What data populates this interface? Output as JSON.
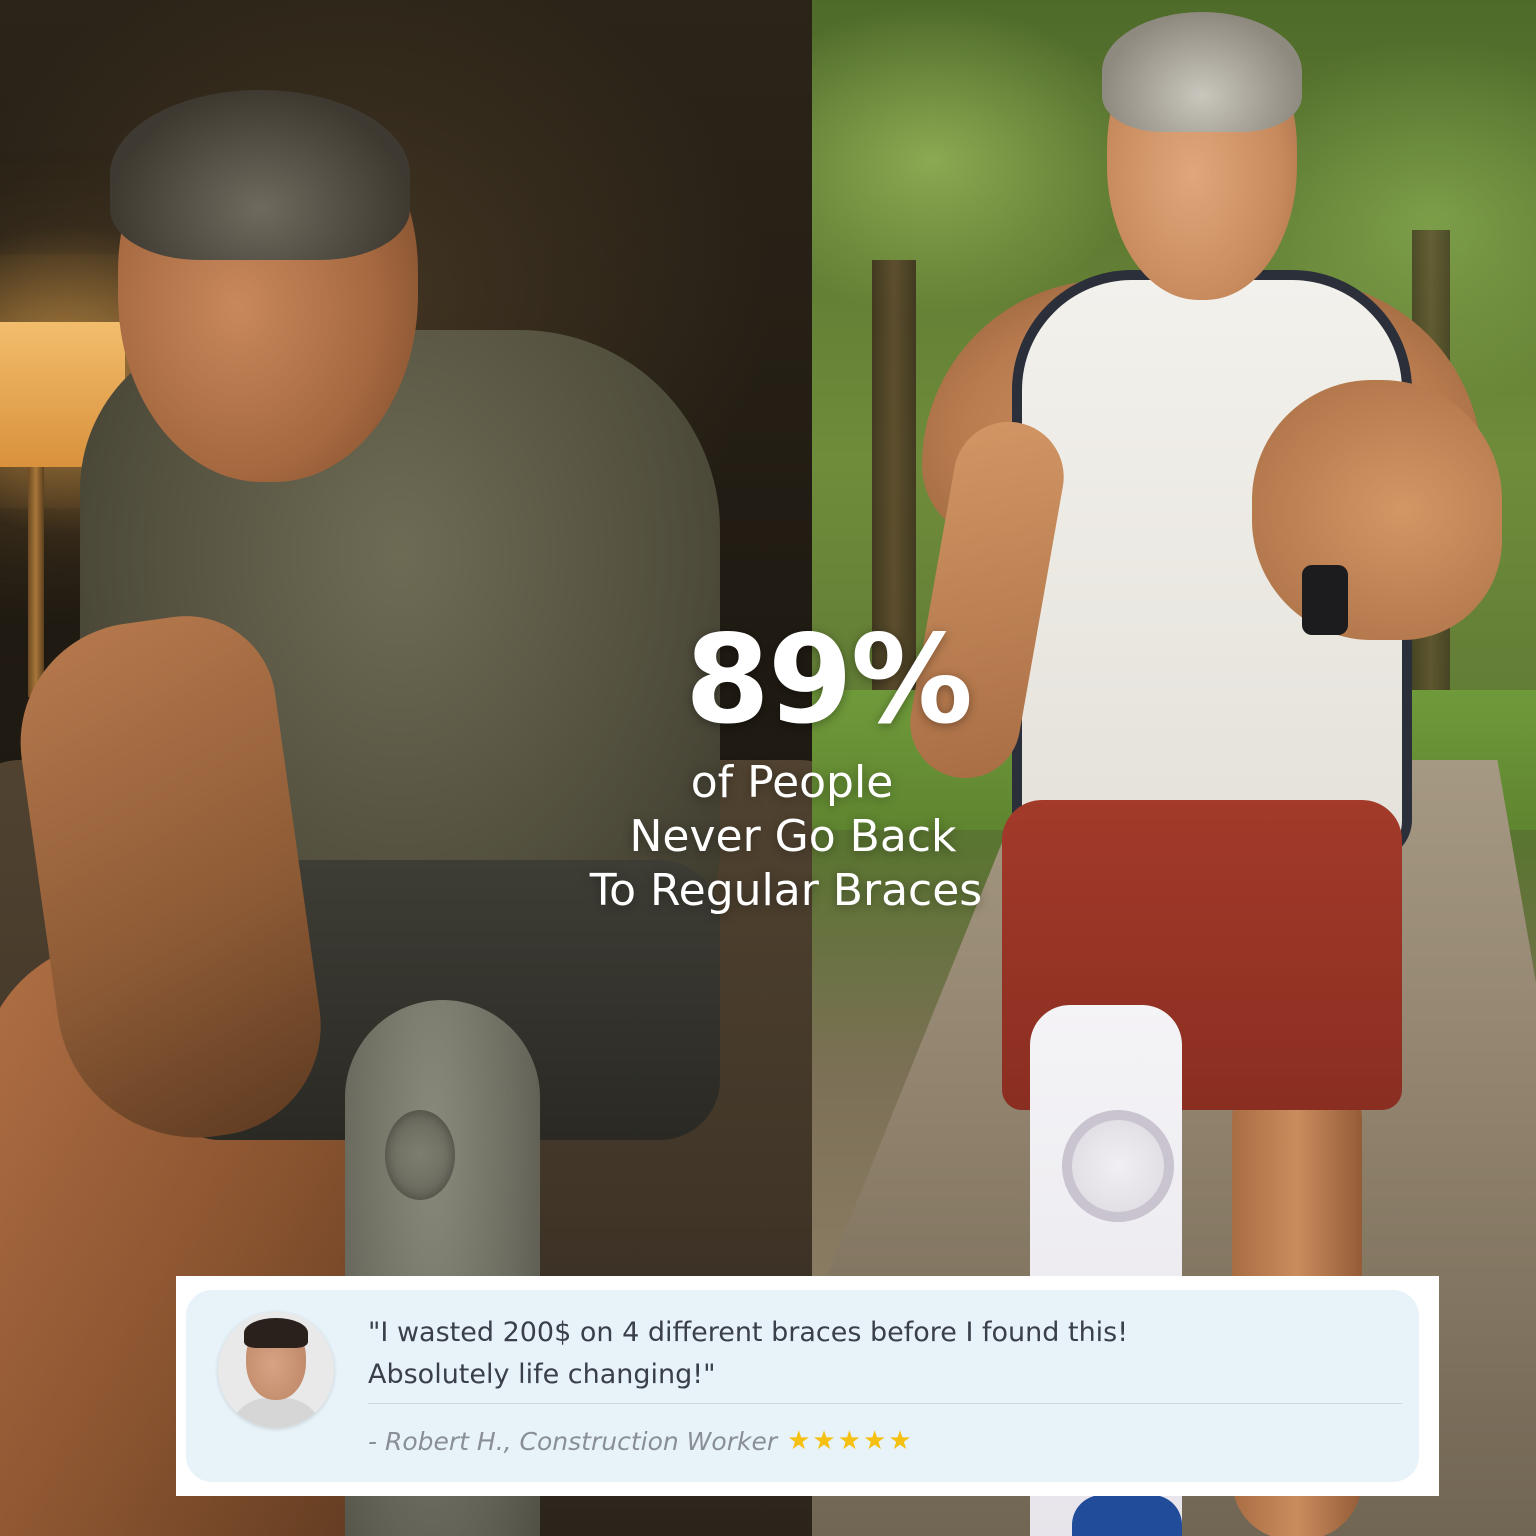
{
  "headline": {
    "stat": "89%",
    "line_1": "of People",
    "line_2": "Never Go Back",
    "line_3": "To Regular Braces"
  },
  "testimonial": {
    "quote_line_1": "\"I wasted 200$ on 4 different braces before I found this!",
    "quote_line_2": "Absolutely life changing!\"",
    "attribution": "- Robert H., Construction Worker",
    "rating_stars": "★★★★★",
    "rating": 5,
    "avatar_icon": "person-avatar"
  },
  "colors": {
    "headline_text": "#ffffff",
    "card_background": "#e8f3f9",
    "quote_text": "#3a3f4a",
    "attribution_text": "#8a8f97",
    "star_color": "#f5c012"
  }
}
